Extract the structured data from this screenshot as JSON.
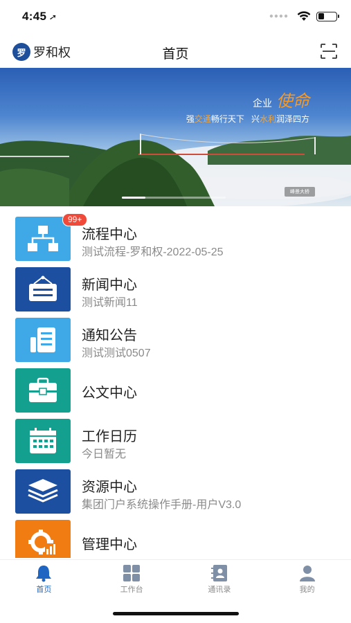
{
  "status_bar": {
    "time": "4:45",
    "location_glyph": "➚"
  },
  "nav": {
    "avatar_char": "罗",
    "user_name": "罗和权",
    "title": "首页"
  },
  "banner": {
    "slogan_prefix": "企业",
    "slogan_mission": "使命",
    "slogan_line_a1": "强",
    "slogan_line_a2": "交通",
    "slogan_line_a3": "畅行天下",
    "slogan_line_b1": "兴",
    "slogan_line_b2": "水利",
    "slogan_line_b3": "润泽四方",
    "badge": "峰景大桥"
  },
  "menu": [
    {
      "title": "流程中心",
      "subtitle": "测试流程-罗和权-2022-05-25",
      "badge": "99+",
      "icon": "flowchart-icon",
      "color": "#3fa9e8"
    },
    {
      "title": "新闻中心",
      "subtitle": "测试新闻11",
      "icon": "news-board-icon",
      "color": "#1d4fa0"
    },
    {
      "title": "通知公告",
      "subtitle": "测试测试0507",
      "icon": "notice-document-icon",
      "color": "#3fa9e8"
    },
    {
      "title": "公文中心",
      "subtitle": "",
      "icon": "briefcase-icon",
      "color": "#14a08f"
    },
    {
      "title": "工作日历",
      "subtitle": "今日暂无",
      "icon": "calendar-icon",
      "color": "#14a08f"
    },
    {
      "title": "资源中心",
      "subtitle": "集团门户系统操作手册-用户V3.0",
      "icon": "layers-icon",
      "color": "#1d4fa0"
    },
    {
      "title": "管理中心",
      "subtitle": "",
      "icon": "management-gear-chart-icon",
      "color": "#f07c12"
    }
  ],
  "tabs": [
    {
      "label": "首页",
      "icon": "bell-home-icon",
      "active": true
    },
    {
      "label": "工作台",
      "icon": "workbench-grid-icon",
      "active": false
    },
    {
      "label": "通讯录",
      "icon": "contacts-book-icon",
      "active": false
    },
    {
      "label": "我的",
      "icon": "user-profile-icon",
      "active": false
    }
  ],
  "colors": {
    "accent": "#1f66c2",
    "badge": "#f04a3b"
  }
}
